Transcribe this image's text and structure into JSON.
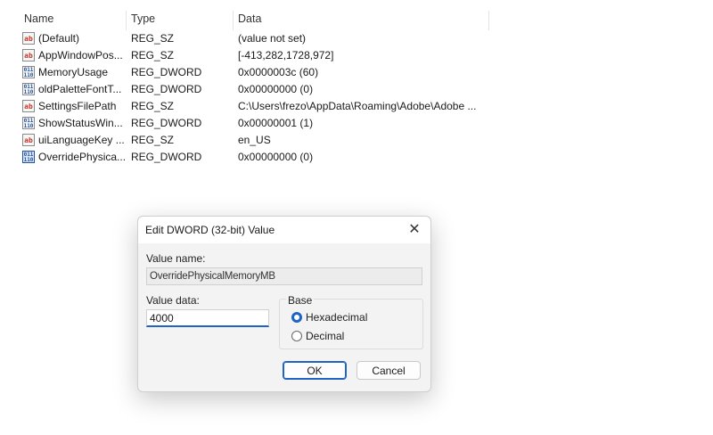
{
  "list": {
    "headers": {
      "name": "Name",
      "type": "Type",
      "data": "Data"
    },
    "rows": [
      {
        "icon": "string-value-icon",
        "glyph": "ab",
        "name": "(Default)",
        "type": "REG_SZ",
        "data": "(value not set)"
      },
      {
        "icon": "string-value-icon",
        "glyph": "ab",
        "name": "AppWindowPos...",
        "type": "REG_SZ",
        "data": "[-413,282,1728,972]"
      },
      {
        "icon": "dword-value-icon",
        "glyph": "011 110",
        "name": "MemoryUsage",
        "type": "REG_DWORD",
        "data": "0x0000003c (60)"
      },
      {
        "icon": "dword-value-icon",
        "glyph": "011 110",
        "name": "oldPaletteFontT...",
        "type": "REG_DWORD",
        "data": "0x00000000 (0)"
      },
      {
        "icon": "string-value-icon",
        "glyph": "ab",
        "name": "SettingsFilePath",
        "type": "REG_SZ",
        "data": "C:\\Users\\frezo\\AppData\\Roaming\\Adobe\\Adobe ..."
      },
      {
        "icon": "dword-value-icon",
        "glyph": "011 110",
        "name": "ShowStatusWin...",
        "type": "REG_DWORD",
        "data": "0x00000001 (1)"
      },
      {
        "icon": "string-value-icon",
        "glyph": "ab",
        "name": "uiLanguageKey ...",
        "type": "REG_SZ",
        "data": "en_US"
      },
      {
        "icon": "dword-value-icon",
        "glyph": "011 110",
        "name": "OverridePhysica...",
        "type": "REG_DWORD",
        "data": "0x00000000 (0)"
      }
    ]
  },
  "dialog": {
    "title": "Edit DWORD (32-bit) Value",
    "close_glyph": "✕",
    "value_name_label": "Value name:",
    "value_name": "OverridePhysicalMemoryMB",
    "value_data_label": "Value data:",
    "value_data": "4000",
    "base_label": "Base",
    "base_options": [
      "Hexadecimal",
      "Decimal"
    ],
    "base_selected": "Hexadecimal",
    "ok_label": "OK",
    "cancel_label": "Cancel"
  },
  "colors": {
    "accent": "#1f63c4",
    "dialog_bg": "#f3f3f3"
  }
}
